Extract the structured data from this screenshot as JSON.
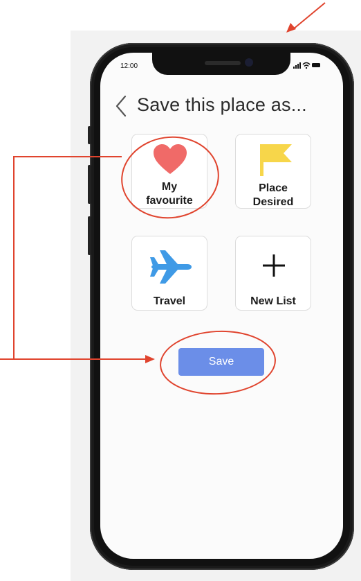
{
  "status_bar": {
    "time": "12:00"
  },
  "header": {
    "title": "Save this place as..."
  },
  "tiles": [
    {
      "line1": "My",
      "line2": "favourite",
      "icon": "heart-icon",
      "icon_color": "#f06a68"
    },
    {
      "line1": "Place",
      "line2": "Desired",
      "icon": "flag-icon",
      "icon_color": "#f7d64a"
    },
    {
      "line1": "Travel",
      "line2": "",
      "icon": "airplane-icon",
      "icon_color": "#3f9ae6"
    },
    {
      "line1": "New List",
      "line2": "",
      "icon": "plus-icon",
      "icon_color": "#111111"
    }
  ],
  "save_button": {
    "label": "Save",
    "color": "#6b8ee8"
  },
  "annotation_color": "#e0442e"
}
